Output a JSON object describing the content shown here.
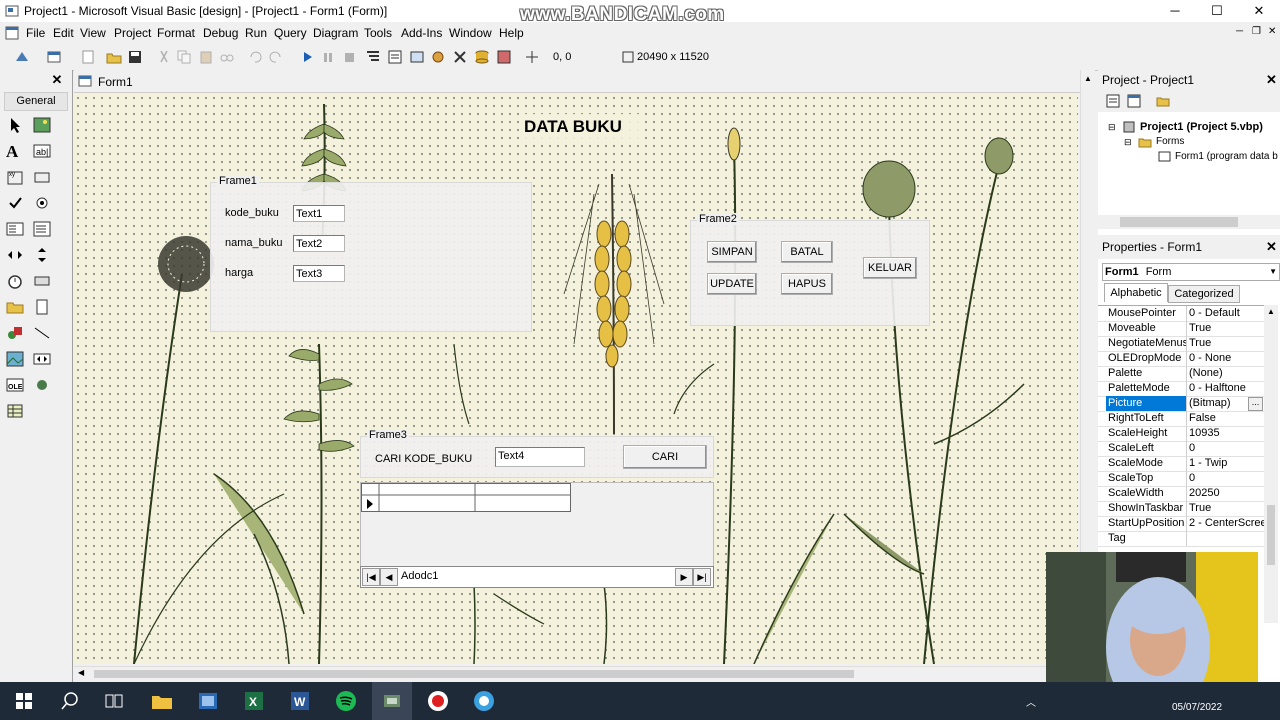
{
  "window": {
    "title": "Project1 - Microsoft Visual Basic [design] - [Project1 - Form1 (Form)]",
    "watermark": "www.BANDICAM.com",
    "min": "─",
    "max": "☐",
    "close": "✕"
  },
  "menu": [
    "File",
    "Edit",
    "View",
    "Project",
    "Format",
    "Debug",
    "Run",
    "Query",
    "Diagram",
    "Tools",
    "Add-Ins",
    "Window",
    "Help"
  ],
  "toolbar": {
    "position": "0, 0",
    "size": "20490 x 11520"
  },
  "toolbox": {
    "title": "General"
  },
  "form_window": {
    "title": "Form1"
  },
  "form": {
    "heading": "DATA BUKU",
    "frame1": {
      "caption": "Frame1",
      "labels": [
        "kode_buku",
        "nama_buku",
        "harga"
      ],
      "texts": [
        "Text1",
        "Text2",
        "Text3"
      ]
    },
    "frame2": {
      "caption": "Frame2",
      "buttons": {
        "simpan": "SIMPAN",
        "batal": "BATAL",
        "update": "UPDATE",
        "hapus": "HAPUS",
        "keluar": "KELUAR"
      }
    },
    "frame3": {
      "caption": "Frame3",
      "label": "CARI KODE_BUKU",
      "text": "Text4",
      "button": "CARI",
      "adodc": "Adodc1"
    }
  },
  "project": {
    "title": "Project - Project1",
    "root": "Project1 (Project 5.vbp)",
    "folder": "Forms",
    "item": "Form1 (program data b"
  },
  "properties": {
    "title": "Properties - Form1",
    "object": "Form1",
    "object_type": "Form",
    "tab_alpha": "Alphabetic",
    "tab_cat": "Categorized",
    "selected": "Picture",
    "rows": [
      {
        "k": "MousePointer",
        "v": "0 - Default"
      },
      {
        "k": "Moveable",
        "v": "True"
      },
      {
        "k": "NegotiateMenus",
        "v": "True"
      },
      {
        "k": "OLEDropMode",
        "v": "0 - None"
      },
      {
        "k": "Palette",
        "v": "(None)"
      },
      {
        "k": "PaletteMode",
        "v": "0 - Halftone"
      },
      {
        "k": "Picture",
        "v": "(Bitmap)"
      },
      {
        "k": "RightToLeft",
        "v": "False"
      },
      {
        "k": "ScaleHeight",
        "v": "10935"
      },
      {
        "k": "ScaleLeft",
        "v": "0"
      },
      {
        "k": "ScaleMode",
        "v": "1 - Twip"
      },
      {
        "k": "ScaleTop",
        "v": "0"
      },
      {
        "k": "ScaleWidth",
        "v": "20250"
      },
      {
        "k": "ShowInTaskbar",
        "v": "True"
      },
      {
        "k": "StartUpPosition",
        "v": "2 - CenterScree"
      },
      {
        "k": "Tag",
        "v": ""
      }
    ]
  },
  "taskbar": {
    "date": "05/07/2022"
  },
  "colors": {
    "selection": "#0078d7",
    "taskbar": "#1f2a38",
    "canvas": "#f4f1dc"
  }
}
